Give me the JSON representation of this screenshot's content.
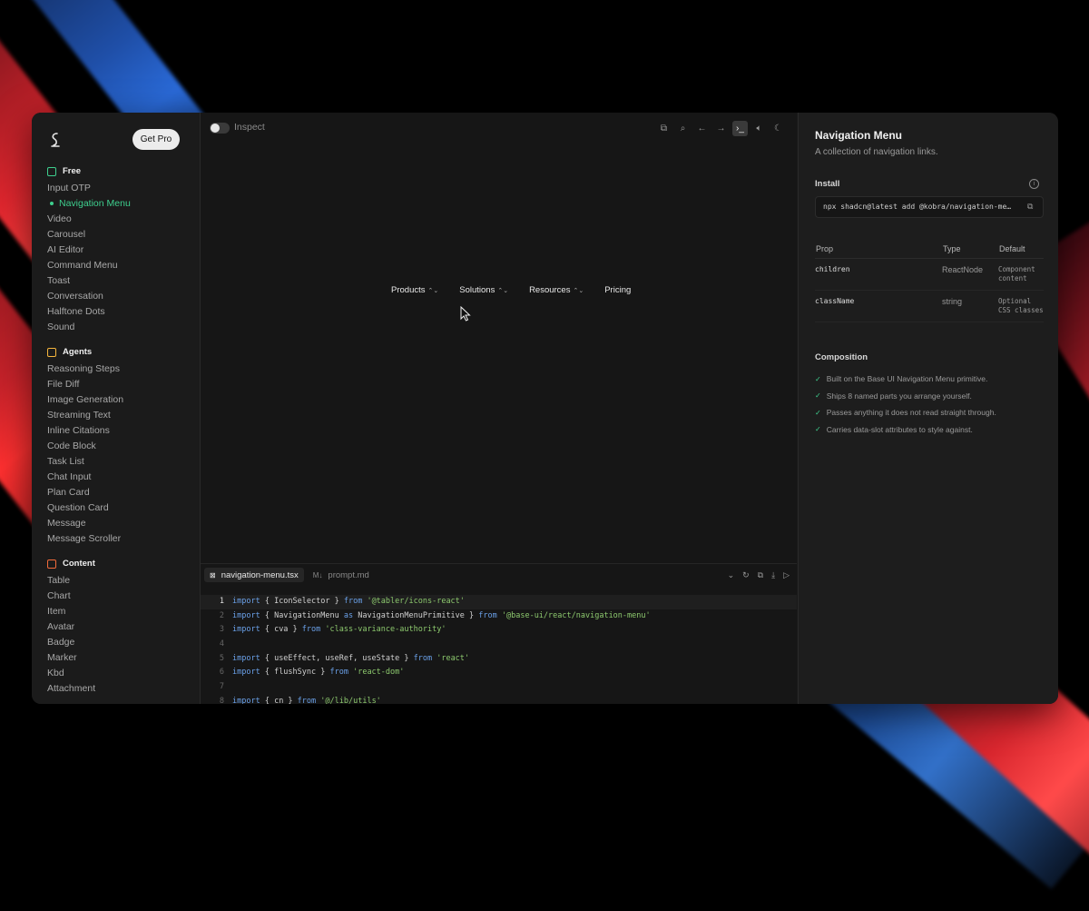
{
  "sidebar": {
    "get_pro": "Get Pro",
    "sections": [
      {
        "title": "Free",
        "icon": "gift-icon",
        "color": "#3ecf8e",
        "items": [
          "Input OTP",
          "Navigation Menu",
          "Video",
          "Carousel",
          "AI Editor",
          "Command Menu",
          "Toast",
          "Conversation",
          "Halftone Dots",
          "Sound"
        ]
      },
      {
        "title": "Agents",
        "icon": "calendar-icon",
        "color": "#f5b53d",
        "items": [
          "Reasoning Steps",
          "File Diff",
          "Image Generation",
          "Streaming Text",
          "Inline Citations",
          "Code Block",
          "Task List",
          "Chat Input",
          "Plan Card",
          "Question Card",
          "Message",
          "Message Scroller"
        ]
      },
      {
        "title": "Content",
        "icon": "square-icon",
        "color": "#f26b3a",
        "items": [
          "Table",
          "Chart",
          "Item",
          "Avatar",
          "Badge",
          "Marker",
          "Kbd",
          "Attachment"
        ]
      }
    ],
    "active_item": "Navigation Menu"
  },
  "main": {
    "inspect_label": "Inspect",
    "toolbar_icons": [
      "copy-icon",
      "search-icon",
      "arrow-left-icon",
      "arrow-right-icon",
      "terminal-icon",
      "volume-icon",
      "moon-icon"
    ],
    "demo_nav": [
      "Products",
      "Solutions",
      "Resources",
      "Pricing"
    ],
    "editor": {
      "tabs": [
        {
          "label": "navigation-menu.tsx",
          "icon": "file-code-icon"
        },
        {
          "label": "prompt.md",
          "icon": "markdown-icon",
          "prefix": "M↓"
        }
      ],
      "lines": [
        {
          "n": "1",
          "parts": [
            [
              "kw",
              "import"
            ],
            [
              "txt",
              " { IconSelector } "
            ],
            [
              "kw",
              "from"
            ],
            [
              "str",
              " '@tabler/icons-react'"
            ]
          ]
        },
        {
          "n": "2",
          "parts": [
            [
              "kw",
              "import"
            ],
            [
              "txt",
              " { NavigationMenu "
            ],
            [
              "kw",
              "as"
            ],
            [
              "txt",
              " NavigationMenuPrimitive } "
            ],
            [
              "kw",
              "from"
            ],
            [
              "str",
              " '@base-ui/react/navigation-menu'"
            ]
          ]
        },
        {
          "n": "3",
          "parts": [
            [
              "kw",
              "import"
            ],
            [
              "txt",
              " { cva } "
            ],
            [
              "kw",
              "from"
            ],
            [
              "str",
              " 'class-variance-authority'"
            ]
          ]
        },
        {
          "n": "4",
          "parts": []
        },
        {
          "n": "5",
          "parts": [
            [
              "kw",
              "import"
            ],
            [
              "txt",
              " { useEffect, useRef, useState } "
            ],
            [
              "kw",
              "from"
            ],
            [
              "str",
              " 'react'"
            ]
          ]
        },
        {
          "n": "6",
          "parts": [
            [
              "kw",
              "import"
            ],
            [
              "txt",
              " { flushSync } "
            ],
            [
              "kw",
              "from"
            ],
            [
              "str",
              " 'react-dom'"
            ]
          ]
        },
        {
          "n": "7",
          "parts": []
        },
        {
          "n": "8",
          "parts": [
            [
              "kw",
              "import"
            ],
            [
              "txt",
              " { cn } "
            ],
            [
              "kw",
              "from"
            ],
            [
              "str",
              " '@/lib/utils'"
            ]
          ]
        }
      ]
    }
  },
  "panel": {
    "title": "Navigation Menu",
    "description": "A collection of navigation links.",
    "install_label": "Install",
    "install_cmd": "npx shadcn@latest add @kobra/navigation-me…",
    "props_headers": [
      "Prop",
      "Type",
      "Default"
    ],
    "props": [
      {
        "name": "children",
        "type": "ReactNode",
        "default": "Component content"
      },
      {
        "name": "className",
        "type": "string",
        "default": "Optional CSS classes"
      }
    ],
    "composition_label": "Composition",
    "composition": [
      "Built on the Base UI Navigation Menu primitive.",
      "Ships 8 named parts you arrange yourself.",
      "Passes anything it does not read straight through.",
      "Carries data-slot attributes to style against."
    ]
  }
}
